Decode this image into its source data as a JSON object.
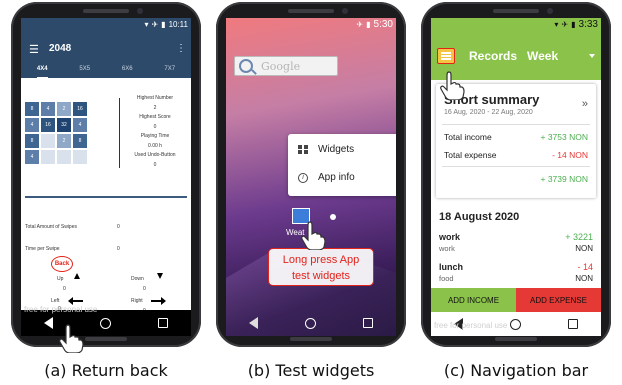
{
  "captions": {
    "a": "(a) Return back",
    "b": "(b) Test widgets",
    "c": "(c) Navigation bar"
  },
  "watermark": "free for personal use",
  "panel_a": {
    "status_time": "10:11",
    "app_title": "2048",
    "tabs": [
      "4X4",
      "5X5",
      "6X6",
      "7X7"
    ],
    "board": [
      [
        "8",
        "4",
        "2",
        "16"
      ],
      [
        "4",
        "16",
        "32",
        "4"
      ],
      [
        "8",
        "",
        "2",
        "8"
      ],
      [
        "4",
        "",
        "",
        ""
      ]
    ],
    "stats": {
      "highest_number_label": "Highest Number",
      "highest_number": "2",
      "highest_score_label": "Highest Score",
      "highest_score": "0",
      "playing_time_label": "Playing Time",
      "playing_time": "0.00 h",
      "undo_label": "Used Undo-Button",
      "undo": "0"
    },
    "swipes_label": "Total Amount of Swipes",
    "swipes_value": "0",
    "time_per_swipe_label": "Time per Swipe",
    "time_per_swipe_value": "0",
    "up_label": "Up",
    "up_value": "0",
    "down_label": "Down",
    "down_value": "0",
    "left_label": "Left",
    "left_value": "0",
    "right_label": "Right",
    "right_value": "0",
    "back_button": "Back"
  },
  "panel_b": {
    "status_time": "5:30",
    "search_placeholder": "Google",
    "menu": {
      "widgets": "Widgets",
      "app_info": "App info"
    },
    "app_label": "Weat",
    "callout": [
      "Long press App",
      "test widgets"
    ]
  },
  "panel_c": {
    "status_time": "3:33",
    "tab_records": "Records",
    "period": "Week",
    "summary": {
      "title": "Short summary",
      "dates": "16 Aug, 2020 - 22 Aug, 2020",
      "income_label": "Total income",
      "income_value": "+ 3753 NON",
      "expense_label": "Total expense",
      "expense_value": "- 14 NON",
      "net_value": "+ 3739 NON"
    },
    "day_header": "18 August 2020",
    "entries": [
      {
        "name": "work",
        "category": "work",
        "amount": "+ 3221",
        "currency": "NON"
      },
      {
        "name": "lunch",
        "category": "food",
        "amount": "- 14",
        "currency": "NON"
      }
    ],
    "add_income": "ADD INCOME",
    "add_expense": "ADD EXPENSE"
  },
  "colors": {
    "a_toolbar": "#2d4a6b",
    "c_toolbar": "#8bc34a",
    "expense_red": "#e53935",
    "highlight_red": "#e2231a"
  }
}
